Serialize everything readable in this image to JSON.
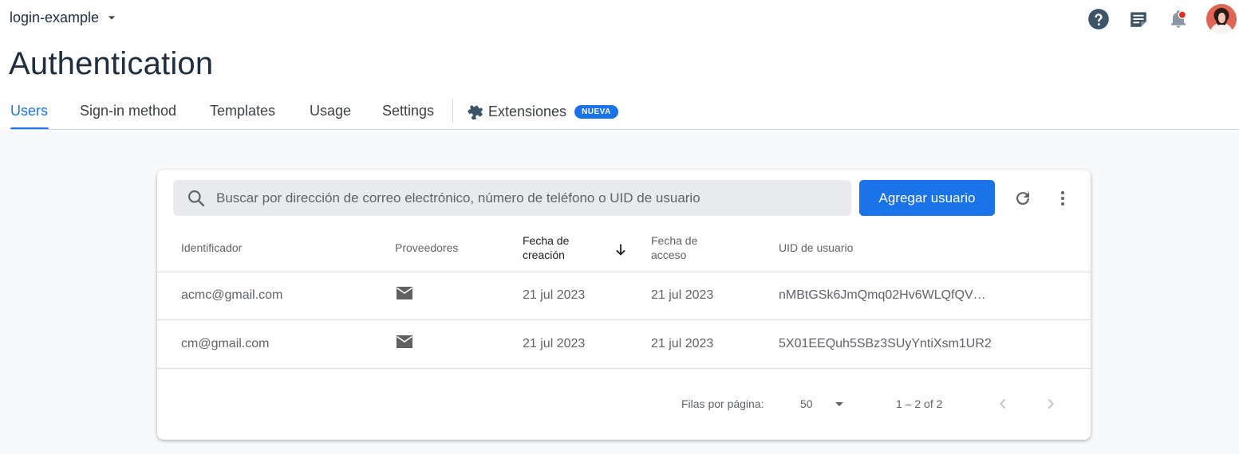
{
  "topbar": {
    "project_name": "login-example",
    "icons": [
      "help-icon",
      "release-notes-icon",
      "notifications-icon"
    ],
    "avatar": "user-avatar"
  },
  "page": {
    "title": "Authentication"
  },
  "tabs": [
    {
      "label": "Users",
      "active": true
    },
    {
      "label": "Sign-in method"
    },
    {
      "label": "Templates"
    },
    {
      "label": "Usage"
    },
    {
      "label": "Settings"
    },
    {
      "label": "Extensiones",
      "badge": "NUEVA",
      "icon": "extension-puzzle-icon"
    }
  ],
  "toolbar": {
    "search_placeholder": "Buscar por dirección de correo electrónico, número de teléfono o UID de usuario",
    "add_user_label": "Agregar usuario",
    "refresh_icon": "refresh-icon",
    "more_icon": "more-vert-icon"
  },
  "table": {
    "columns": {
      "identifier": "Identificador",
      "providers": "Proveedores",
      "created_line1": "Fecha de",
      "created_line2": "creación",
      "signed_in_line1": "Fecha de",
      "signed_in_line2": "acceso",
      "uid": "UID de usuario"
    },
    "sort": {
      "column": "created",
      "direction": "descending"
    },
    "rows": [
      {
        "identifier": "acmc@gmail.com",
        "provider": "email-icon",
        "created": "21 jul 2023",
        "signed_in": "21 jul 2023",
        "uid": "nMBtGSk6JmQmq02Hv6WLQfQV…"
      },
      {
        "identifier": "cm@gmail.com",
        "provider": "email-icon",
        "created": "21 jul 2023",
        "signed_in": "21 jul 2023",
        "uid": "5X01EEQuh5SBz3SUyYntiXsm1UR2"
      }
    ]
  },
  "pagination": {
    "rows_per_page_label": "Filas por página:",
    "rows_per_page_value": "50",
    "range": "1 – 2 of 2"
  },
  "colors": {
    "accent": "#1a73e8",
    "title": "#1f2d3d",
    "notification_dot": "#d93025"
  }
}
